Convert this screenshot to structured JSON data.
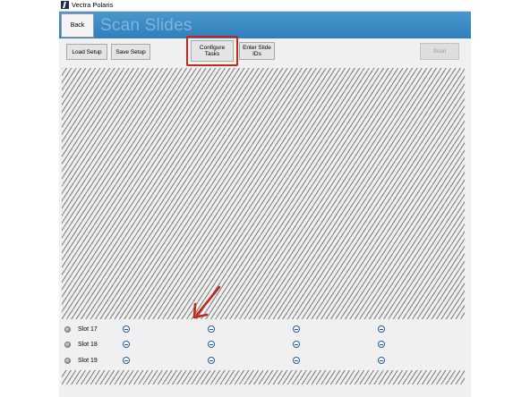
{
  "window": {
    "title": "Vectra Polaris"
  },
  "header": {
    "back_label": "Back",
    "page_title": "Scan Slides"
  },
  "toolbar": {
    "load_setup": "Load Setup",
    "save_setup": "Save Setup",
    "configure_tasks_line1": "Configure",
    "configure_tasks_line2": "Tasks",
    "enter_slide_ids_line1": "Enter Slide",
    "enter_slide_ids_line2": "IDs",
    "scan": "Scan"
  },
  "slots": [
    {
      "label": "Slot 17"
    },
    {
      "label": "Slot 18"
    },
    {
      "label": "Slot 19"
    }
  ],
  "colors": {
    "header": "#3d8cc4",
    "highlight": "#c0281c",
    "minus_icon": "#2456a8"
  }
}
